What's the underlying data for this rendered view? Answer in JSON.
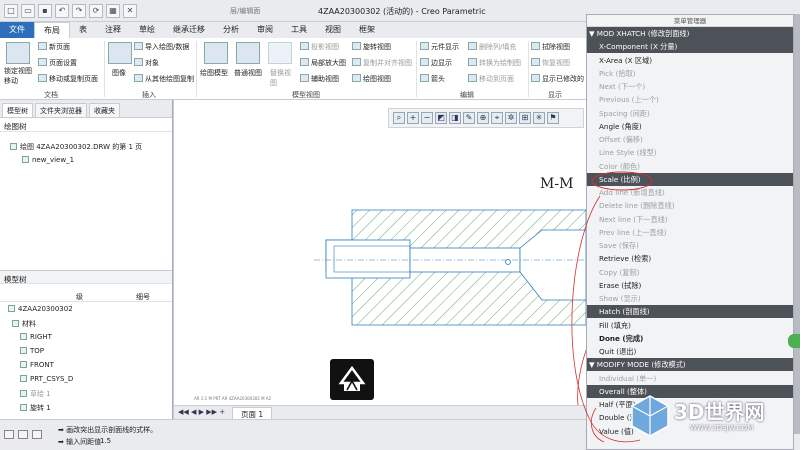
{
  "window": {
    "title": "4ZAA20300302 (活动的) - Creo Parametric",
    "qat_hint": "层/编辑面"
  },
  "menu_tabs": [
    "文件",
    "布局",
    "表",
    "注释",
    "草绘",
    "继承迁移",
    "分析",
    "审阅",
    "工具",
    "视图",
    "框架"
  ],
  "ribbon": {
    "doc": {
      "lock": "锁定视图移动",
      "new_page": "新页面",
      "page_setup": "页面设置",
      "move_copy": "移动或复制页面",
      "group": "文档"
    },
    "insert": {
      "image": "图像",
      "import": "导入绘图/数据",
      "object": "对象",
      "from_other": "从其他绘图复制",
      "group": "插入"
    },
    "model_views": {
      "general": "绘图模型",
      "normal": "普通视图",
      "replace": "替换视图",
      "projection": "投影视图",
      "detail": "局部放大图",
      "aux": "辅助视图",
      "rotate": "旋转视图",
      "copy_align": "复制并对齐视图",
      "drawing_view": "绘图视图",
      "group": "模型视图"
    },
    "edit": {
      "show": "元件显示",
      "edge": "边显示",
      "arrow": "箭头",
      "delete_cross": "删除列/填充",
      "convert": "转换为绘制图",
      "move_special": "移动到页面",
      "group": "编辑"
    },
    "display": {
      "fit": "拭除视图",
      "restore": "恢复视图",
      "show_mod": "显示已修改的",
      "group": "显示"
    }
  },
  "left_panel": {
    "tabs": [
      "模型树",
      "文件夹浏览器",
      "收藏夹"
    ],
    "drawing_tree_title": "绘图树",
    "drawing_item": "绘图 4ZAA20300302.DRW 的第 1 页",
    "view_item": "new_view_1",
    "model_tree_title": "模型树",
    "cols": [
      "级",
      "细号"
    ],
    "model_items": [
      "4ZAA20300302",
      "材料",
      "RIGHT",
      "TOP",
      "FRONT",
      "PRT_CSYS_D",
      "草绘 1",
      "旋转 1"
    ]
  },
  "canvas": {
    "section_label": "M-M",
    "sheet_tab": "页面 1",
    "footer_text": "AR 1:1  M  PRT  AR  4ZAA20300302  M  A2"
  },
  "status": {
    "msg1": "➡ 画改突出显示剖面线的式样。",
    "msg2": "➡ 输入间距值",
    "msg2_val": "1.5"
  },
  "menu_manager": {
    "title": "菜单管理器",
    "items": [
      {
        "label": "▼ MOD XHATCH (修改剖面线)",
        "style": "hdr"
      },
      {
        "label": "X-Component (X 分量)",
        "style": "sel"
      },
      {
        "label": "X-Area (X 区域)",
        "style": ""
      },
      {
        "label": "Pick (拾取)",
        "style": "dim"
      },
      {
        "label": "Next (下一个)",
        "style": "dim"
      },
      {
        "label": "Previous (上一个)",
        "style": "dim"
      },
      {
        "label": "Spacing (间距)",
        "style": "dim"
      },
      {
        "label": "Angle (角度)",
        "style": ""
      },
      {
        "label": "Offset (偏移)",
        "style": "dim"
      },
      {
        "label": "Line Style (线型)",
        "style": "dim"
      },
      {
        "label": "Color (颜色)",
        "style": "dim"
      },
      {
        "label": "Scale (比例)",
        "style": "sel"
      },
      {
        "label": "Add line (新增直线)",
        "style": "dim"
      },
      {
        "label": "Delete line (删除直线)",
        "style": "dim"
      },
      {
        "label": "Next line (下一直线)",
        "style": "dim"
      },
      {
        "label": "Prev line (上一直线)",
        "style": "dim"
      },
      {
        "label": "Save (保存)",
        "style": "dim"
      },
      {
        "label": "Retrieve (检索)",
        "style": ""
      },
      {
        "label": "Copy (复制)",
        "style": "dim"
      },
      {
        "label": "Erase (拭除)",
        "style": ""
      },
      {
        "label": "Show (显示)",
        "style": "dim"
      },
      {
        "label": "Hatch (剖面线)",
        "style": "sel"
      },
      {
        "label": "Fill (填充)",
        "style": ""
      },
      {
        "label": "Done (完成)",
        "style": "bold"
      },
      {
        "label": "Quit (退出)",
        "style": ""
      },
      {
        "label": "▼ MODIFY MODE (修改模式)",
        "style": "hdr"
      },
      {
        "label": "Individual (单一)",
        "style": "dim"
      },
      {
        "label": "Overall (整体)",
        "style": "sel"
      },
      {
        "label": "Half (平面)",
        "style": ""
      },
      {
        "label": "Double (双倍)",
        "style": ""
      },
      {
        "label": "Value (值)",
        "style": ""
      }
    ]
  },
  "watermark": {
    "brand": "3D世界网",
    "url": "WWW.3DSJW.COM"
  },
  "colors": {
    "file_tab": "#2d6fba",
    "hatch": "#3a9a4a",
    "outline": "#2b7bc0",
    "annot": "#d23030",
    "menu_sel": "#4d5259"
  }
}
